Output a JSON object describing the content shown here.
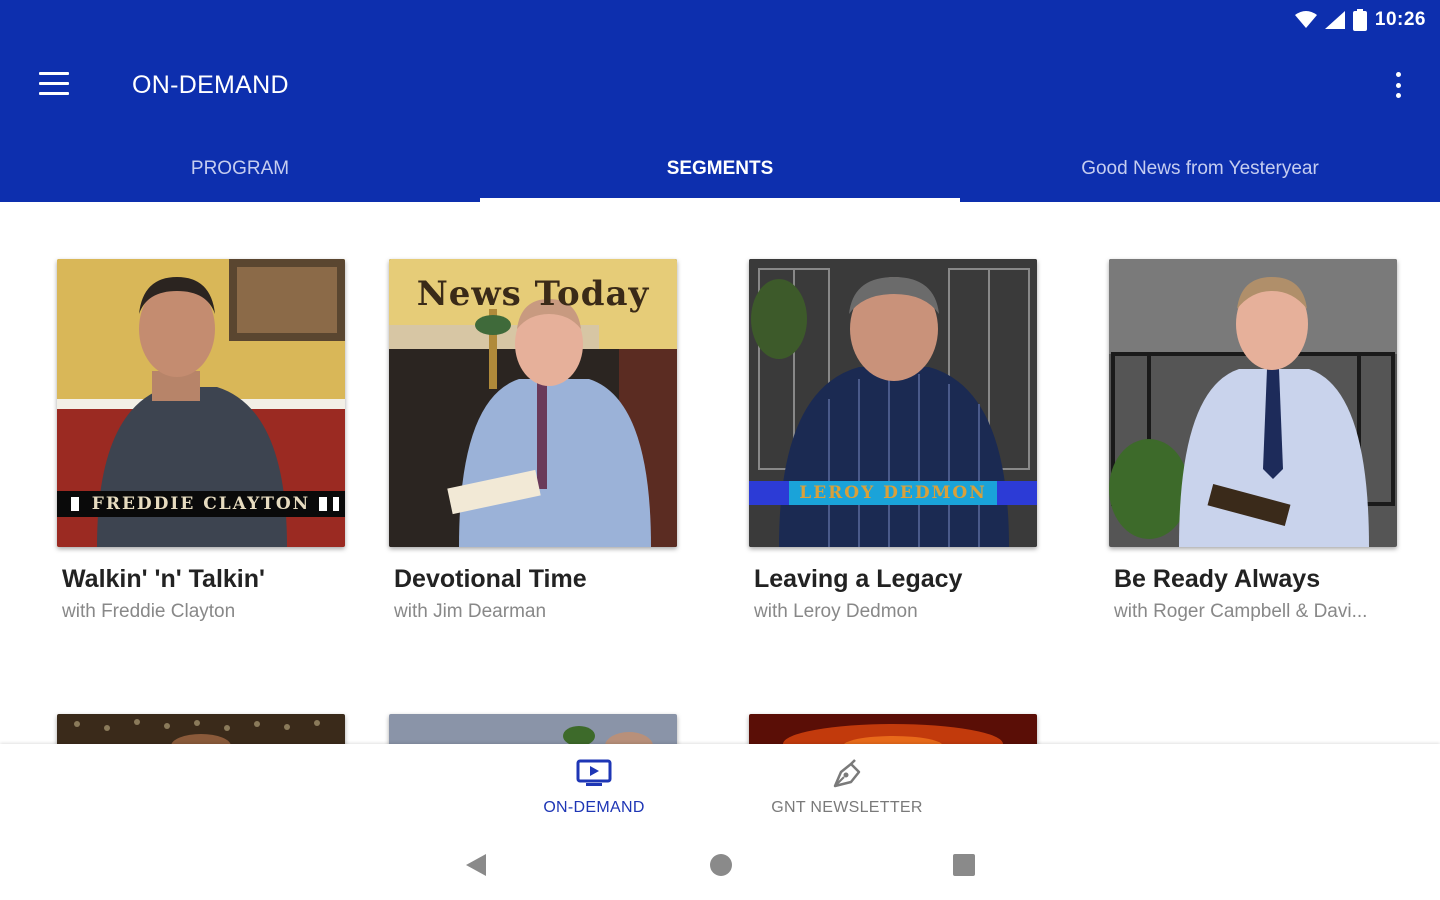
{
  "status_bar": {
    "time": "10:26",
    "icons": [
      "wifi-icon",
      "signal-icon",
      "battery-icon"
    ]
  },
  "toolbar": {
    "title": "ON-DEMAND",
    "menu_icon": "hamburger-menu-icon",
    "overflow_icon": "more-vert-icon"
  },
  "tabs": [
    {
      "label": "PROGRAM",
      "active": false
    },
    {
      "label": "SEGMENTS",
      "active": true
    },
    {
      "label": "Good News from Yesteryear",
      "active": false
    }
  ],
  "segments": [
    {
      "title": "Walkin' 'n' Talkin'",
      "subtitle": "with Freddie Clayton",
      "overlay": "FREDDIE CLAYTON"
    },
    {
      "title": "Devotional Time",
      "subtitle": "with Jim Dearman",
      "overlay": "News Today"
    },
    {
      "title": "Leaving a Legacy",
      "subtitle": "with Leroy Dedmon",
      "overlay": "LEROY DEDMON"
    },
    {
      "title": "Be Ready Always",
      "subtitle": "with Roger Campbell & Davi..."
    }
  ],
  "bottom_nav": [
    {
      "label": "ON-DEMAND",
      "icon": "ondemand-tv-icon",
      "active": true
    },
    {
      "label": "GNT NEWSLETTER",
      "icon": "pen-nib-icon",
      "active": false
    }
  ],
  "system_nav": {
    "icons": [
      "back-icon",
      "home-icon",
      "recents-icon"
    ]
  },
  "colors": {
    "primary": "#0d2fae",
    "active_nav": "#1e36b5",
    "inactive_text": "#7a7a7a"
  }
}
